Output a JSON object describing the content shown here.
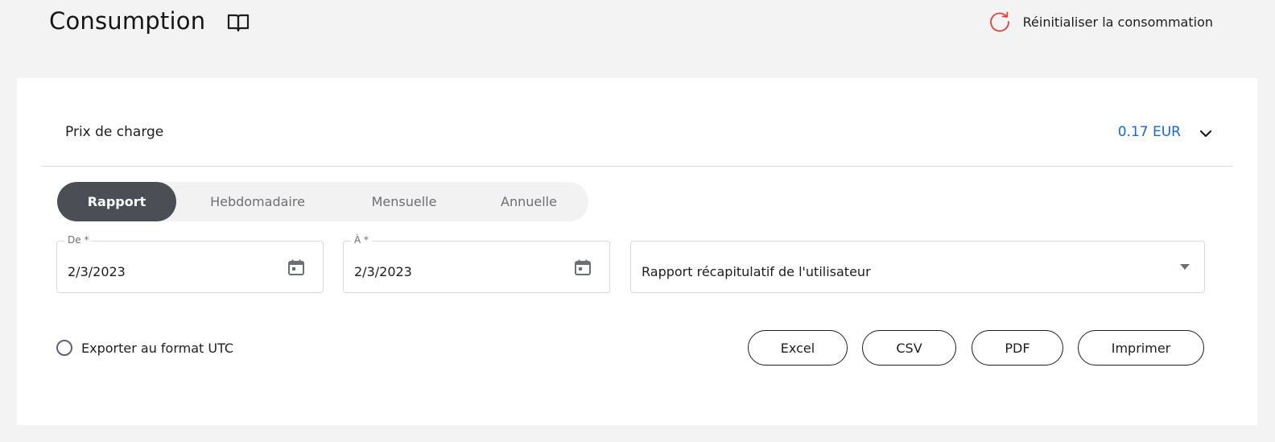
{
  "header": {
    "title": "Consumption",
    "reset_label": "Réinitialiser la consommation"
  },
  "price": {
    "label": "Prix de charge",
    "value": "0.17 EUR"
  },
  "tabs": [
    {
      "label": "Rapport",
      "active": true
    },
    {
      "label": "Hebdomadaire",
      "active": false
    },
    {
      "label": "Mensuelle",
      "active": false
    },
    {
      "label": "Annuelle",
      "active": false
    }
  ],
  "form": {
    "from": {
      "label": "De *",
      "value": "2/3/2023"
    },
    "to": {
      "label": "À *",
      "value": "2/3/2023"
    },
    "report_type": {
      "value": "Rapport récapitulatif de l'utilisateur"
    }
  },
  "export": {
    "utc_label": "Exporter au format UTC",
    "utc_checked": false
  },
  "buttons": {
    "excel": "Excel",
    "csv": "CSV",
    "pdf": "PDF",
    "print": "Imprimer"
  },
  "colors": {
    "accent_blue": "#1665e6",
    "reset_icon_red": "#e0413a",
    "active_tab_bg": "#4b4f55",
    "page_bg": "#f3f3f3"
  },
  "icons": {
    "header_doc": "book-open-icon",
    "reset": "refresh-icon",
    "price_toggle": "chevron-down-icon",
    "date": "calendar-icon",
    "select": "caret-down-icon"
  }
}
